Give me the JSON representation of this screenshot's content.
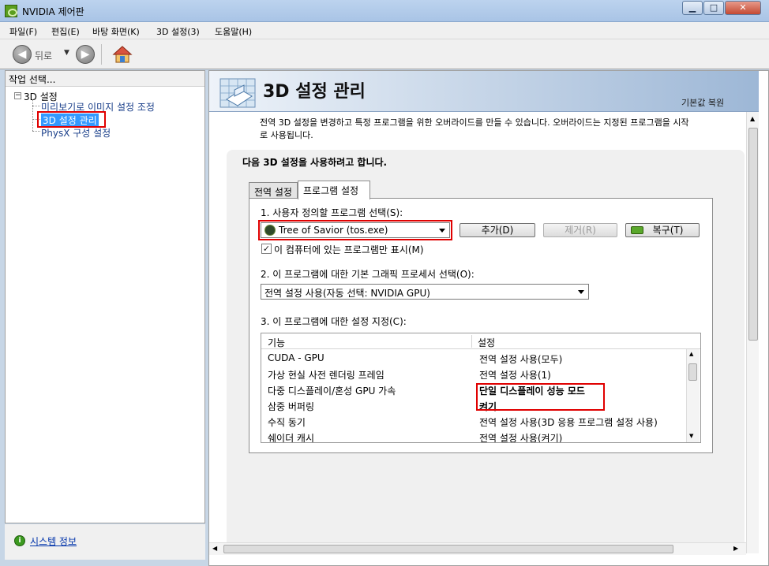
{
  "window": {
    "title": "NVIDIA 제어판",
    "min": "▁",
    "max": "□",
    "close": "✕"
  },
  "menu": [
    "파일(F)",
    "편집(E)",
    "바탕 화면(K)",
    "3D 설정(3)",
    "도움말(H)"
  ],
  "toolbar": {
    "back_label": "뒤로",
    "back_icon": "back-arrow-icon",
    "forward_icon": "forward-arrow-icon",
    "home_icon": "home-icon"
  },
  "left": {
    "header": "작업 선택...",
    "root": "3D 설정",
    "items": [
      "미리보기로 이미지 설정 조정",
      "3D 설정 관리",
      "PhysX 구성 설정"
    ],
    "system_info": "시스템 정보"
  },
  "right": {
    "title": "3D 설정 관리",
    "restore": "기본값 복원",
    "description_line1": "전역 3D 설정을 변경하고 특정 프로그램을 위한 오버라이드를 만들 수 있습니다. 오버라이드는 지정된 프로그램을 시작",
    "description_line2": "로 사용됩니다.",
    "group_title": "다음 3D 설정을 사용하려고 합니다.",
    "tabs": [
      "전역 설정",
      "프로그램 설정"
    ],
    "step1_label": "1. 사용자 정의할 프로그램 선택(S):",
    "program_selected": "Tree of Savior (tos.exe)",
    "add_button": "추가(D)",
    "remove_button": "제거(R)",
    "restore_button": "복구(T)",
    "checkbox_label": "이 컴퓨터에 있는 프로그램만 표시(M)",
    "checkbox_checked": true,
    "step2_label": "2. 이 프로그램에 대한 기본 그래픽 프로세서 선택(O):",
    "gpu_selected": "전역 설정 사용(자동 선택: NVIDIA GPU)",
    "step3_label": "3. 이 프로그램에 대한 설정 지정(C):",
    "table_headers": [
      "기능",
      "설정"
    ],
    "table_rows": [
      [
        "CUDA - GPU",
        "전역 설정 사용(모두)"
      ],
      [
        "가상 현실 사전 렌더링 프레임",
        "전역 설정 사용(1)"
      ],
      [
        "다중 디스플레이/혼성 GPU 가속",
        "단일 디스플레이 성능 모드"
      ],
      [
        "삼중 버퍼링",
        "켜기"
      ],
      [
        "수직 동기",
        "전역 설정 사용(3D 응용 프로그램 설정 사용)"
      ],
      [
        "쉐이더 캐시",
        "전역 설정 사용(켜기)"
      ]
    ]
  },
  "colors": {
    "highlight_red": "#e00000",
    "link_blue": "#0033aa"
  }
}
